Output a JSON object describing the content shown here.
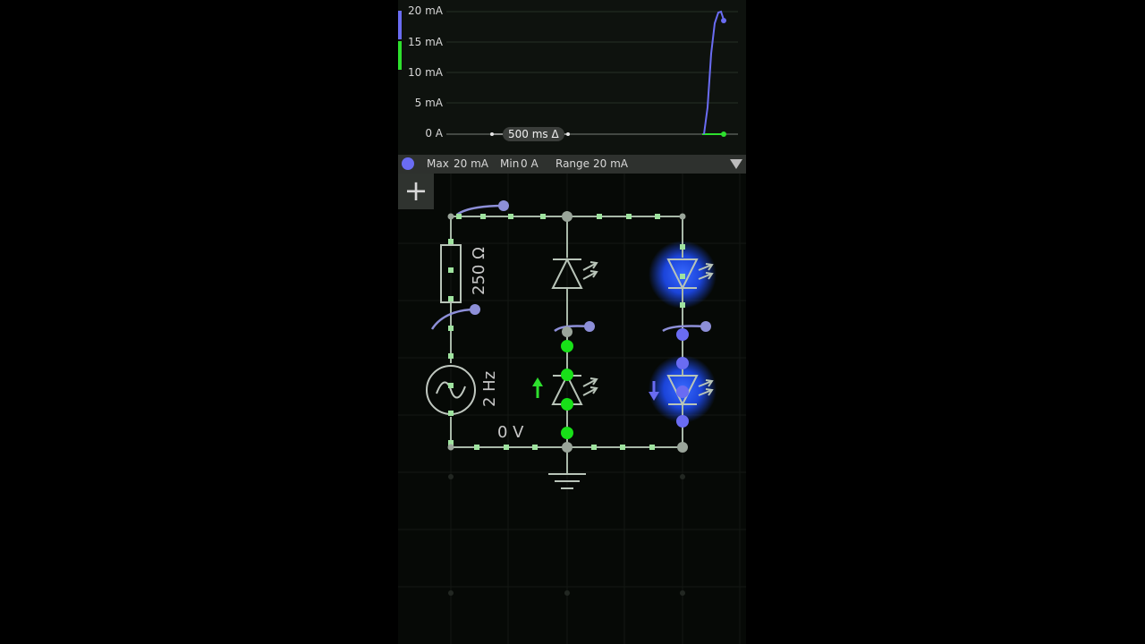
{
  "scope": {
    "y_labels": [
      "20 mA",
      "15 mA",
      "10 mA",
      "5 mA",
      "0 A"
    ],
    "time_delta": "500 ms Δ",
    "trace_colors": {
      "current": "#6a6cf2",
      "secondary": "#2ee02e"
    }
  },
  "info_bar": {
    "max_label": "Max",
    "max_value": "20 mA",
    "min_label": "Min",
    "min_value": "0 A",
    "range_label": "Range",
    "range_value": "20 mA"
  },
  "toolbar": {
    "add_label": "+"
  },
  "components": {
    "resistor_value": "250 Ω",
    "source_frequency": "2 Hz",
    "ground_voltage": "0 V"
  },
  "colors": {
    "wire": "#a8b8a8",
    "node": "#9fe39f",
    "led_glow": "#1a4dff",
    "probe": "#8d8fd8"
  }
}
